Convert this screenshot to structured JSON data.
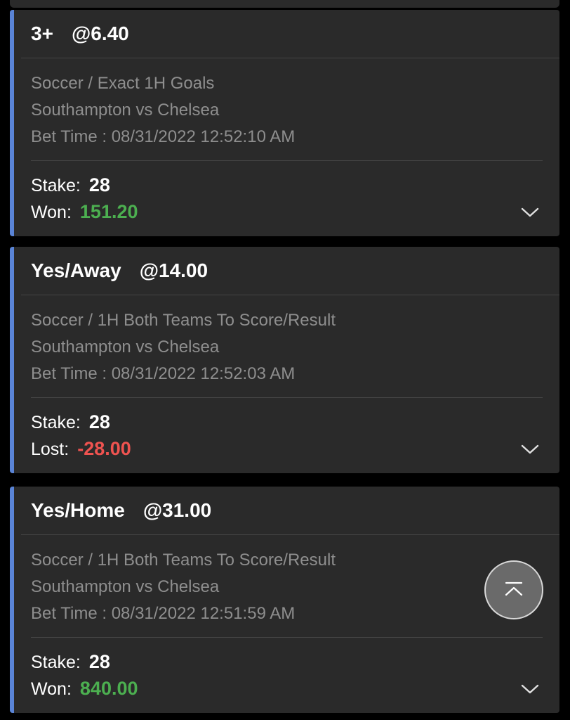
{
  "bets": [
    {
      "selection": "3+",
      "odds": "@6.40",
      "market": "Soccer / Exact 1H Goals",
      "match": "Southampton vs Chelsea",
      "bet_time": "Bet Time : 08/31/2022 12:52:10 AM",
      "stake_label": "Stake:",
      "stake": "28",
      "result_label": "Won:",
      "result_value": "151.20",
      "result_status": "won"
    },
    {
      "selection": "Yes/Away",
      "odds": "@14.00",
      "market": "Soccer / 1H Both Teams To Score/Result",
      "match": "Southampton vs Chelsea",
      "bet_time": "Bet Time : 08/31/2022 12:52:03 AM",
      "stake_label": "Stake:",
      "stake": "28",
      "result_label": "Lost:",
      "result_value": "-28.00",
      "result_status": "lost"
    },
    {
      "selection": "Yes/Home",
      "odds": "@31.00",
      "market": "Soccer / 1H Both Teams To Score/Result",
      "match": "Southampton vs Chelsea",
      "bet_time": "Bet Time : 08/31/2022 12:51:59 AM",
      "stake_label": "Stake:",
      "stake": "28",
      "result_label": "Won:",
      "result_value": "840.00",
      "result_status": "won"
    }
  ],
  "icons": {
    "expand": "chevron-down-icon",
    "scroll_top": "arrow-up-to-top-icon"
  },
  "colors": {
    "accent": "#5a84d6",
    "won": "#4caf50",
    "lost": "#ef5350",
    "card_bg": "#2a2a2a"
  }
}
